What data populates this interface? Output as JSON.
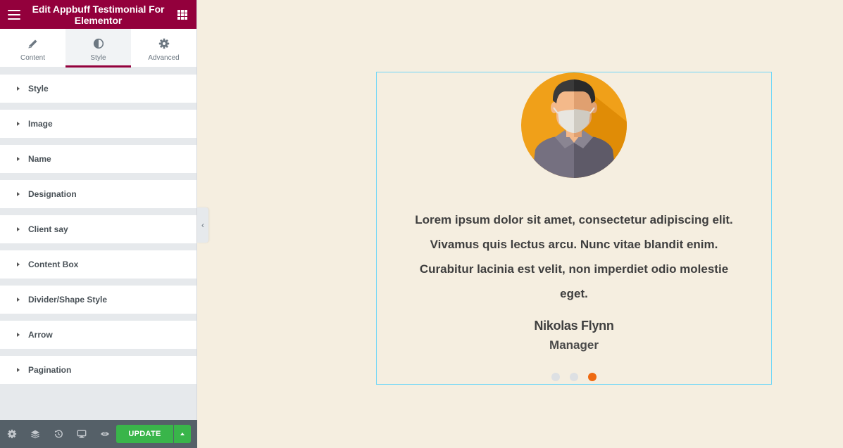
{
  "editor": {
    "title": "Edit Appbuff Testimonial For Elementor",
    "tabs": [
      {
        "label": "Content",
        "icon": "pencil-icon"
      },
      {
        "label": "Style",
        "icon": "half-circle-icon"
      },
      {
        "label": "Advanced",
        "icon": "gear-icon"
      }
    ],
    "active_tab": "Style",
    "sections": [
      {
        "label": "Style"
      },
      {
        "label": "Image"
      },
      {
        "label": "Name"
      },
      {
        "label": "Designation"
      },
      {
        "label": "Client say"
      },
      {
        "label": "Content Box"
      },
      {
        "label": "Divider/Shape Style"
      },
      {
        "label": "Arrow"
      },
      {
        "label": "Pagination"
      }
    ],
    "footer": {
      "icons": [
        "settings-icon",
        "layers-icon",
        "history-icon",
        "responsive-icon",
        "preview-icon"
      ],
      "update_label": "UPDATE"
    },
    "colors": {
      "header": "#93003c",
      "update": "#39b54a",
      "footer": "#556068"
    }
  },
  "preview": {
    "background": "#f5eee0",
    "testimonial": {
      "quote": "Lorem ipsum dolor sit amet, consectetur adipiscing elit. Vivamus quis lectus arcu. Nunc vitae blandit enim. Curabitur lacinia est velit, non imperdiet odio molestie eget.",
      "name": "Nikolas Flynn",
      "designation": "Manager"
    },
    "pagination": {
      "total": 3,
      "active": 3,
      "active_color": "#ee6a12"
    }
  }
}
